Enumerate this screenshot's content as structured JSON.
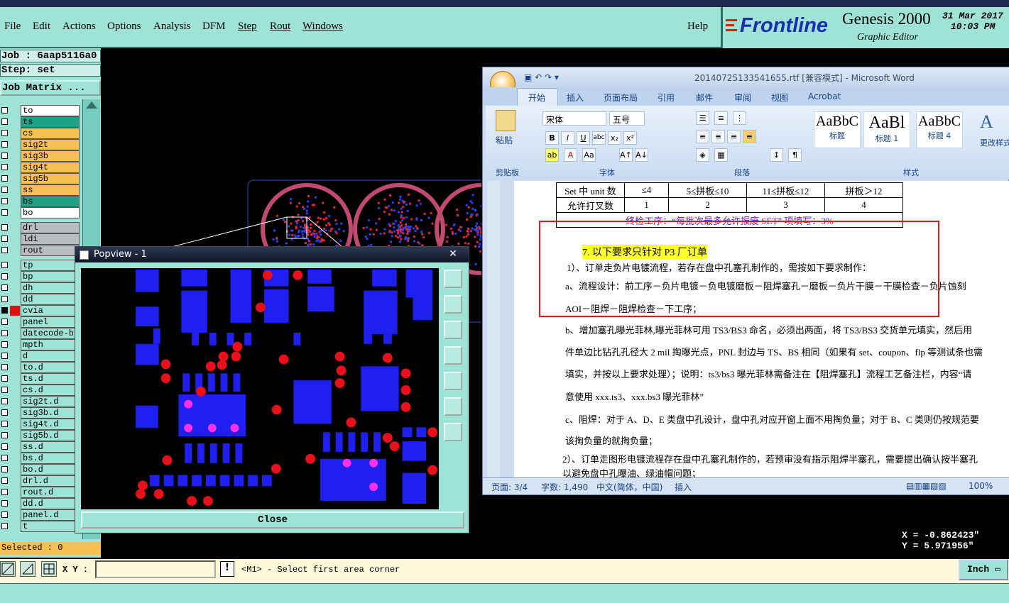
{
  "genesis": {
    "menu": [
      "File",
      "Edit",
      "Actions",
      "Options",
      "Analysis",
      "DFM",
      "Step",
      "Rout",
      "Windows"
    ],
    "help": "Help",
    "brand_logo": "Frontline",
    "brand_title": "Genesis 2000",
    "brand_subtitle": "Graphic Editor",
    "date_line1": "31 Mar 2017",
    "date_line2": "10:03 PM",
    "job": "Job : 6aap5116a0",
    "step": "Step: set",
    "job_matrix": "Job Matrix ...",
    "layers": [
      {
        "name": "to",
        "bg": "#ffffff",
        "icon": "",
        "checked": false
      },
      {
        "name": "ts",
        "bg": "#1ea187",
        "icon": "",
        "checked": false
      },
      {
        "name": "cs",
        "bg": "#f8bf52",
        "icon": "",
        "checked": false
      },
      {
        "name": "sig2t",
        "bg": "#f8bf52",
        "icon": "",
        "checked": false
      },
      {
        "name": "sig3b",
        "bg": "#f8bf52",
        "icon": "",
        "checked": false
      },
      {
        "name": "sig4t",
        "bg": "#f8bf52",
        "icon": "",
        "checked": false
      },
      {
        "name": "sig5b",
        "bg": "#f8bf52",
        "icon": "",
        "checked": false
      },
      {
        "name": "ss",
        "bg": "#f8bf52",
        "icon": "",
        "checked": false
      },
      {
        "name": "bs",
        "bg": "#1ea187",
        "icon": "",
        "checked": false
      },
      {
        "name": "bo",
        "bg": "#ffffff",
        "icon": "",
        "checked": false
      },
      {
        "name": "drl",
        "bg": "#b9bcc1",
        "icon": "",
        "checked": false
      },
      {
        "name": "ldi",
        "bg": "#b9bcc1",
        "icon": "",
        "checked": false
      },
      {
        "name": "rout",
        "bg": "#b9bcc1",
        "icon": "",
        "checked": false
      },
      {
        "name": "tp",
        "bg": "#9fe3d6",
        "icon": "",
        "checked": false
      },
      {
        "name": "bp",
        "bg": "#9fe3d6",
        "icon": "",
        "checked": false
      },
      {
        "name": "dh",
        "bg": "#9fe3d6",
        "icon": "",
        "checked": false
      },
      {
        "name": "dd",
        "bg": "#9fe3d6",
        "icon": "",
        "checked": false
      },
      {
        "name": "cvia",
        "bg": "#9fe3d6",
        "icon": "red",
        "checked": true
      },
      {
        "name": "panel",
        "bg": "#9fe3d6",
        "icon": "",
        "checked": false
      },
      {
        "name": "datecode-b",
        "bg": "#9fe3d6",
        "icon": "",
        "checked": false
      },
      {
        "name": "mpth",
        "bg": "#9fe3d6",
        "icon": "",
        "checked": false
      },
      {
        "name": "d",
        "bg": "#9fe3d6",
        "icon": "",
        "checked": false
      },
      {
        "name": "to.d",
        "bg": "#9fe3d6",
        "icon": "",
        "checked": false
      },
      {
        "name": "ts.d",
        "bg": "#9fe3d6",
        "icon": "",
        "checked": false
      },
      {
        "name": "cs.d",
        "bg": "#9fe3d6",
        "icon": "",
        "checked": false
      },
      {
        "name": "sig2t.d",
        "bg": "#9fe3d6",
        "icon": "",
        "checked": false
      },
      {
        "name": "sig3b.d",
        "bg": "#9fe3d6",
        "icon": "",
        "checked": false
      },
      {
        "name": "sig4t.d",
        "bg": "#9fe3d6",
        "icon": "",
        "checked": false
      },
      {
        "name": "sig5b.d",
        "bg": "#9fe3d6",
        "icon": "",
        "checked": false
      },
      {
        "name": "ss.d",
        "bg": "#9fe3d6",
        "icon": "",
        "checked": false
      },
      {
        "name": "bs.d",
        "bg": "#9fe3d6",
        "icon": "",
        "checked": false
      },
      {
        "name": "bo.d",
        "bg": "#9fe3d6",
        "icon": "",
        "checked": false
      },
      {
        "name": "drl.d",
        "bg": "#9fe3d6",
        "icon": "",
        "checked": false
      },
      {
        "name": "rout.d",
        "bg": "#9fe3d6",
        "icon": "",
        "checked": false
      },
      {
        "name": "dd.d",
        "bg": "#9fe3d6",
        "icon": "",
        "checked": false
      },
      {
        "name": "panel.d",
        "bg": "#9fe3d6",
        "icon": "",
        "checked": false
      },
      {
        "name": "t",
        "bg": "#9fe3d6",
        "icon": "",
        "checked": false
      }
    ],
    "selected": "Selected : 0",
    "xy_label": "X Y :",
    "xy_value": "",
    "prompt": "<M1> - Select first area corner",
    "unit": "Inch",
    "coord_x": "X = -0.862423\"",
    "coord_y": "Y = 5.971956\""
  },
  "popview": {
    "title": "Popview - 1",
    "close": "Close",
    "close_x": "✕"
  },
  "word": {
    "title": "20140725133541655.rtf [兼容模式] - Microsoft Word",
    "tabs": [
      "开始",
      "插入",
      "页面布局",
      "引用",
      "邮件",
      "审阅",
      "视图",
      "Acrobat"
    ],
    "paste_label": "粘贴",
    "font_name": "宋体",
    "font_size": "五号",
    "groups": [
      "剪贴板",
      "字体",
      "段落",
      "样式"
    ],
    "styles": [
      {
        "sample": "AaBbC",
        "name": "标题"
      },
      {
        "sample": "AaBl",
        "name": "标题 1"
      },
      {
        "sample": "AaBbC",
        "name": "标题 4"
      }
    ],
    "change_style": "更改样式",
    "table_rows": [
      [
        "Set 中 unit 数",
        "≤4",
        "5≤拼板≤10",
        "11≤拼板≤12",
        "拼板＞12"
      ],
      [
        "允许打叉数",
        "1",
        "2",
        "3",
        "4"
      ]
    ],
    "table_note": "终检工序：“每批次最多允许报废 SET” 项填写：3%",
    "heading7": "7.   以下要求只针对 P3 厂订单",
    "para1": "1）、订单走负片电镀流程，若存在盘中孔塞孔制作的，需按如下要求制作：",
    "para_a": "a、流程设计：前工序－负片电镀－负电镀磨板－阻焊塞孔－磨板－负片干膜－干膜检查－负片蚀刻",
    "para_a2": "AOI－阻焊－阻焊检查－下工序；",
    "para_b1": "b、增加塞孔曝光菲林,曝光菲林可用 TS3/BS3 命名，必须出两面，将 TS3/BS3 交货单元填实，然后用",
    "para_b2": "件单边比钻孔孔径大 2 mil 掏曝光点，PNL 封边与 TS、BS 相同（如果有 set、coupon、flp 等测试条也需",
    "para_b3": "填实，并按以上要求处理）；说明：ts3/bs3 曝光菲林需备注在【阻焊塞孔】流程工艺备注栏，内容“请",
    "para_b4": "意使用 xxx.ts3、xxx.bs3 曝光菲林”",
    "para_c1": "c、阻焊：对于 A、D、E 类盘中孔设计，盘中孔对应开窗上面不用掏负量；对于 B、C 类则仍按规范要",
    "para_c2": "该掏负量的就掏负量；",
    "para2": "2）、订单走图形电镀流程存在盘中孔塞孔制作的，若预审没有指示阻焊半塞孔，需要提出确认按半塞孔",
    "para2b": "以避免盘中孔曝油、绿油帽问题；",
    "status_page": "页面: 3/4",
    "status_words": "字数: 1,490",
    "status_lang": "中文(简体，中国)",
    "status_mode": "插入",
    "zoom": "100%"
  }
}
